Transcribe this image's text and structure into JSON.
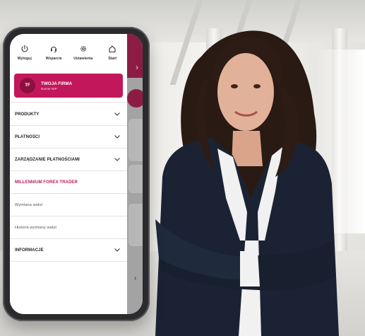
{
  "top_actions": [
    {
      "label": "Wyloguj",
      "icon": "power-icon"
    },
    {
      "label": "Wsparcie",
      "icon": "headset-icon"
    },
    {
      "label": "Ustawienia",
      "icon": "gear-icon"
    },
    {
      "label": "Start",
      "icon": "home-icon"
    }
  ],
  "company": {
    "initials": "TF",
    "name": "TWOJA FIRMA",
    "subtitle": "Numer NIP"
  },
  "menu": {
    "products": "PRODUKTY",
    "payments": "PŁATNOŚCI",
    "payments_management": "ZARZĄDZANIE PŁATNOŚCIAMI",
    "forex_header": "MILLENNIUM FOREX TRADER",
    "currency_exchange": "Wymiana walut",
    "exchange_history": "Historia wymiany walut",
    "info": "INFORMACJE"
  },
  "colors": {
    "brand": "#c2185b",
    "brand_dark": "#8d1c45"
  }
}
